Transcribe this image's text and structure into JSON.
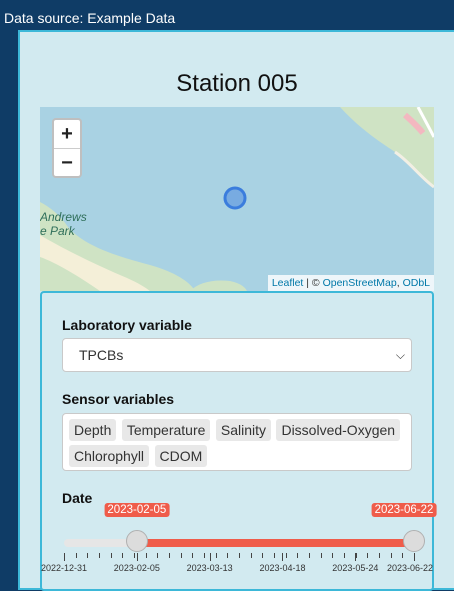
{
  "header": {
    "data_source": "Data source: Example Data"
  },
  "station": {
    "title": "Station 005"
  },
  "map": {
    "zoom_in": "+",
    "zoom_out": "−",
    "place_label_line1": "Andrews",
    "place_label_line2": "e Park",
    "attribution": {
      "leaflet": "Leaflet",
      "separator": " | © ",
      "osm": "OpenStreetMap",
      "comma": ", ",
      "odbl": "ODbL"
    },
    "colors": {
      "water": "#a9d2e3",
      "land": "#cfe3c4",
      "marker": "#3b7ddd"
    }
  },
  "controls": {
    "lab_variable": {
      "label": "Laboratory variable",
      "selected": "TPCBs"
    },
    "sensor_variables": {
      "label": "Sensor variables",
      "tags": [
        "Depth",
        "Temperature",
        "Salinity",
        "Dissolved-Oxygen",
        "Chlorophyll",
        "CDOM"
      ]
    },
    "date": {
      "label": "Date",
      "from": "2023-02-05",
      "to": "2023-06-22",
      "min": "2022-12-31",
      "max": "2023-06-22",
      "tick_labels": [
        "2022-12-31",
        "2023-02-05",
        "2023-03-13",
        "2023-04-18",
        "2023-05-24",
        "2023-06-22"
      ],
      "accent": "#ef5c4a"
    }
  }
}
